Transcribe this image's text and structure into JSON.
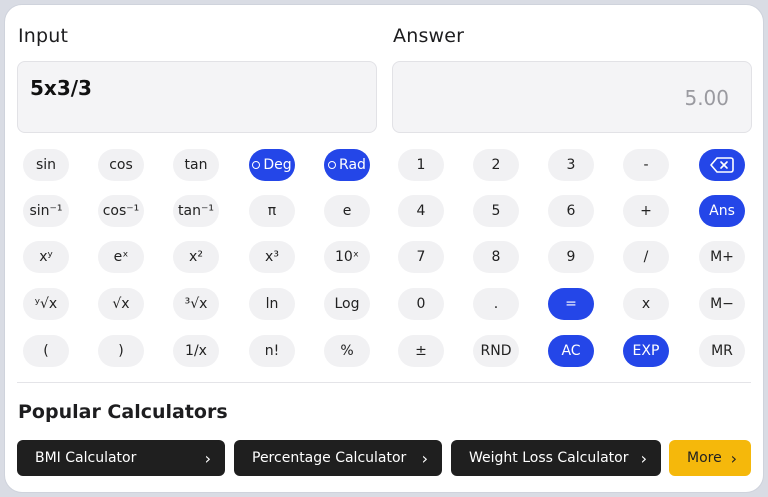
{
  "input_panel": {
    "heading": "Input",
    "value": "5x3/3"
  },
  "answer_panel": {
    "heading": "Answer",
    "value": "5.00"
  },
  "keypad": {
    "row1": [
      "sin",
      "cos",
      "tan",
      "Deg",
      "Rad",
      "1",
      "2",
      "3",
      "-",
      "backspace"
    ],
    "row2": [
      "sin⁻¹",
      "cos⁻¹",
      "tan⁻¹",
      "π",
      "e",
      "4",
      "5",
      "6",
      "+",
      "Ans"
    ],
    "row3": [
      "xʸ",
      "eˣ",
      "x²",
      "x³",
      "10ˣ",
      "7",
      "8",
      "9",
      "/",
      "M+"
    ],
    "row4": [
      "ʸ√x",
      "√x",
      "³√x",
      "ln",
      "Log",
      "0",
      ".",
      "=",
      "x",
      "M−"
    ],
    "row5": [
      "(",
      ")",
      "1/x",
      "n!",
      "%",
      "±",
      "RND",
      "AC",
      "EXP",
      "MR"
    ]
  },
  "popular": {
    "title": "Popular Calculators",
    "buttons": [
      "BMI Calculator",
      "Percentage Calculator",
      "Weight Loss Calculator",
      "More"
    ],
    "chevron": "›"
  },
  "colors": {
    "accent": "#2446e8",
    "more": "#f5b80b",
    "dark_button": "#1f1f1f"
  },
  "icons": {
    "backspace": "backspace-icon",
    "radio": "radio-icon",
    "chevron": "chevron-right-icon"
  }
}
